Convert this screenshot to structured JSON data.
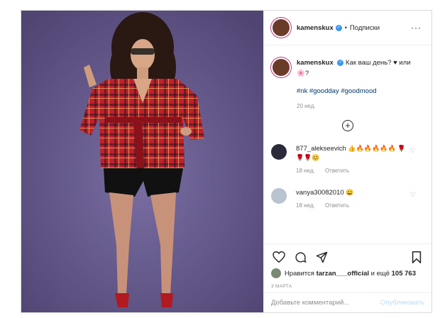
{
  "header": {
    "username": "kamenskux",
    "verified_mark": "✓",
    "separator": "•",
    "follow_label": "Подписки",
    "more_label": "···"
  },
  "caption": {
    "username": "kamenskux",
    "text": "Как ваш день? ♥ или 🌸?",
    "hashtags": "#nk #goodday #goodmood",
    "time": "20 нед."
  },
  "load_more_label": "+",
  "comments": [
    {
      "username": "877_alekseevich",
      "text": "👍🔥🔥🔥🔥🔥 🌹🌹🌹😊",
      "time": "18 нед.",
      "reply_label": "Ответить"
    },
    {
      "username": "vanya30082010",
      "text": "😄",
      "time": "18 нед.",
      "reply_label": "Ответить"
    }
  ],
  "likes": {
    "prefix": "Нравится",
    "user": "tarzan___official",
    "suffix": "и ещё",
    "count": "105 763"
  },
  "post_date": "3 МАРТА",
  "comment_input": {
    "placeholder": "Добавьте комментарий...",
    "publish_label": "Опубликовать"
  },
  "colors": {
    "background": "#5f5283",
    "link": "#00376b",
    "verified": "#3897f0",
    "publish_disabled": "#b2dffc",
    "muted": "#8e8e8e"
  }
}
